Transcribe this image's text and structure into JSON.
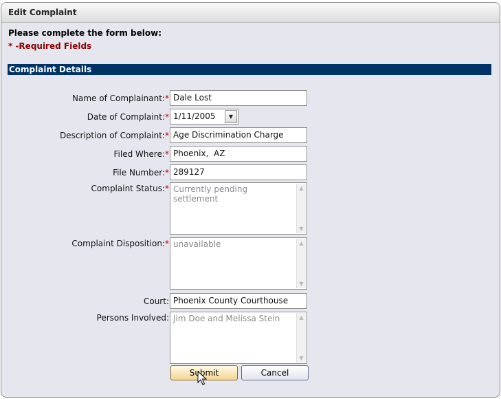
{
  "window": {
    "title": "Edit Complaint"
  },
  "form": {
    "instructions": "Please complete the form below:",
    "required_note": "* -Required Fields",
    "section_title": "Complaint Details",
    "fields": {
      "name": {
        "label": "Name of Complainant:",
        "value": "Dale Lost"
      },
      "date": {
        "label": "Date of Complaint:",
        "value": "1/11/2005"
      },
      "description": {
        "label": "Description of Complaint:",
        "value": "Age Discrimination Charge"
      },
      "filed_where": {
        "label": "Filed Where:",
        "value": "Phoenix,  AZ"
      },
      "file_number": {
        "label": "File Number:",
        "value": "289127"
      },
      "status": {
        "label": "Complaint Status:",
        "value": "Currently pending settlement"
      },
      "disposition": {
        "label": "Complaint Disposition:",
        "value": "unavailable"
      },
      "court": {
        "label": "Court:",
        "value": "Phoenix County Courthouse"
      },
      "persons": {
        "label": "Persons Involved:",
        "value": "Jim Doe and Melissa Stein"
      }
    },
    "required_marker": "*",
    "buttons": {
      "submit": "Submit",
      "cancel": "Cancel"
    }
  },
  "icons": {
    "dropdown": "chevron-down-icon",
    "scroll_up": "scroll-up-arrow-icon",
    "scroll_down": "scroll-down-arrow-icon",
    "cursor": "mouse-pointer-icon"
  },
  "colors": {
    "section_header_bg": "#003366",
    "required": "#c00000",
    "required_note": "#8b0000",
    "window_bg": "#e6e6ee"
  }
}
